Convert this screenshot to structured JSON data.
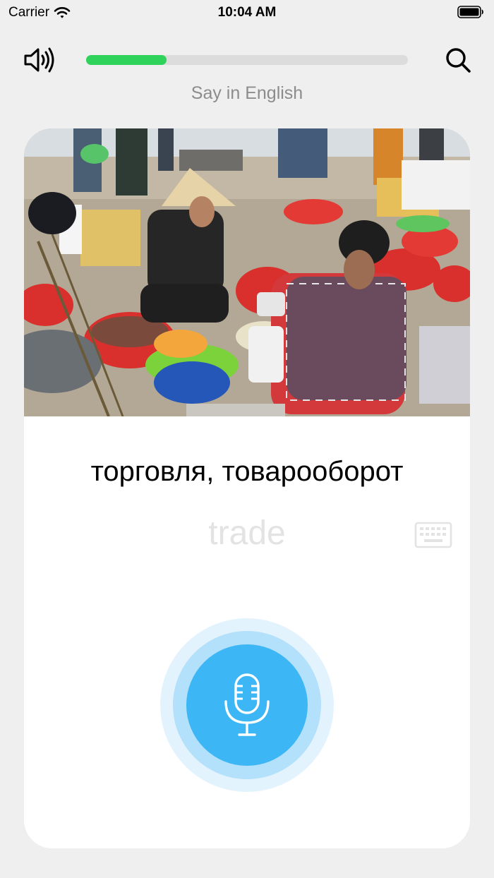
{
  "status_bar": {
    "carrier": "Carrier",
    "time": "10:04 AM"
  },
  "top_bar": {
    "sound_icon": "speaker-icon",
    "search_icon": "search-icon",
    "progress": 0.25
  },
  "instruction": "Say in English",
  "card": {
    "image": "photo of market vendors with basins of seafood on the ground",
    "prompt": "торговля, товарооборот",
    "answer": "trade",
    "keyboard_icon": "keyboard-icon",
    "mic_icon": "microphone-icon"
  },
  "colors": {
    "background": "#efefef",
    "progress": "#2fd35c",
    "mic": "#3db6f5",
    "mic_ring": "#b3e0fa",
    "mic_halo": "#e3f3fd"
  }
}
